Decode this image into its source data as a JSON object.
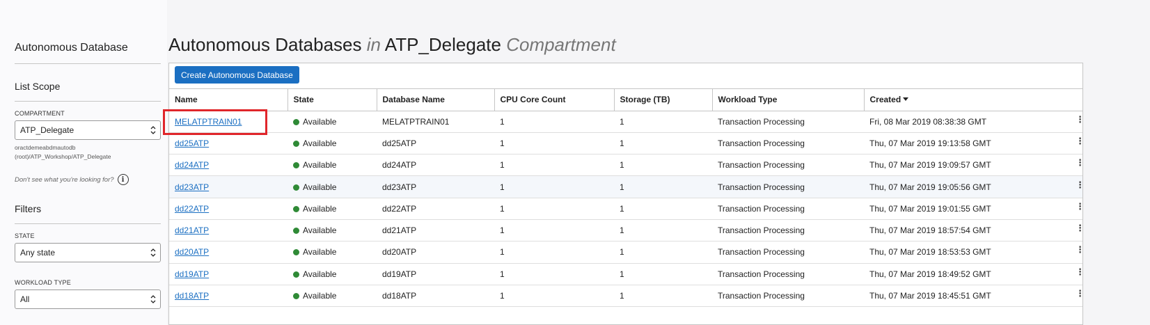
{
  "sidebar": {
    "title": "Autonomous Database",
    "list_scope_title": "List Scope",
    "compartment_label": "COMPARTMENT",
    "compartment_value": "ATP_Delegate",
    "compartment_path": "oractdemeabdmautodb (root)/ATP_Workshop/ATP_Delegate",
    "help_text": "Don't see what you're looking for?",
    "filters_title": "Filters",
    "state_label": "STATE",
    "state_value": "Any state",
    "workload_label": "WORKLOAD TYPE",
    "workload_value": "All"
  },
  "main": {
    "title_part1": "Autonomous Databases",
    "title_in": "in",
    "title_compartment": "ATP_Delegate",
    "title_suffix": "Compartment",
    "create_button": "Create Autonomous Database"
  },
  "table": {
    "columns": [
      "Name",
      "State",
      "Database Name",
      "CPU Core Count",
      "Storage (TB)",
      "Workload Type",
      "Created"
    ],
    "rows": [
      {
        "name": "MELATPTRAIN01",
        "state": "Available",
        "db_name": "MELATPTRAIN01",
        "cpu": "1",
        "storage": "1",
        "workload": "Transaction Processing",
        "created": "Fri, 08 Mar 2019 08:38:38 GMT"
      },
      {
        "name": "dd25ATP",
        "state": "Available",
        "db_name": "dd25ATP",
        "cpu": "1",
        "storage": "1",
        "workload": "Transaction Processing",
        "created": "Thu, 07 Mar 2019 19:13:58 GMT"
      },
      {
        "name": "dd24ATP",
        "state": "Available",
        "db_name": "dd24ATP",
        "cpu": "1",
        "storage": "1",
        "workload": "Transaction Processing",
        "created": "Thu, 07 Mar 2019 19:09:57 GMT"
      },
      {
        "name": "dd23ATP",
        "state": "Available",
        "db_name": "dd23ATP",
        "cpu": "1",
        "storage": "1",
        "workload": "Transaction Processing",
        "created": "Thu, 07 Mar 2019 19:05:56 GMT"
      },
      {
        "name": "dd22ATP",
        "state": "Available",
        "db_name": "dd22ATP",
        "cpu": "1",
        "storage": "1",
        "workload": "Transaction Processing",
        "created": "Thu, 07 Mar 2019 19:01:55 GMT"
      },
      {
        "name": "dd21ATP",
        "state": "Available",
        "db_name": "dd21ATP",
        "cpu": "1",
        "storage": "1",
        "workload": "Transaction Processing",
        "created": "Thu, 07 Mar 2019 18:57:54 GMT"
      },
      {
        "name": "dd20ATP",
        "state": "Available",
        "db_name": "dd20ATP",
        "cpu": "1",
        "storage": "1",
        "workload": "Transaction Processing",
        "created": "Thu, 07 Mar 2019 18:53:53 GMT"
      },
      {
        "name": "dd19ATP",
        "state": "Available",
        "db_name": "dd19ATP",
        "cpu": "1",
        "storage": "1",
        "workload": "Transaction Processing",
        "created": "Thu, 07 Mar 2019 18:49:52 GMT"
      },
      {
        "name": "dd18ATP",
        "state": "Available",
        "db_name": "dd18ATP",
        "cpu": "1",
        "storage": "1",
        "workload": "Transaction Processing",
        "created": "Thu, 07 Mar 2019 18:45:51 GMT"
      }
    ]
  },
  "colors": {
    "primary": "#1b6fc2",
    "available": "#2f8a36",
    "highlight": "#e0262b"
  }
}
